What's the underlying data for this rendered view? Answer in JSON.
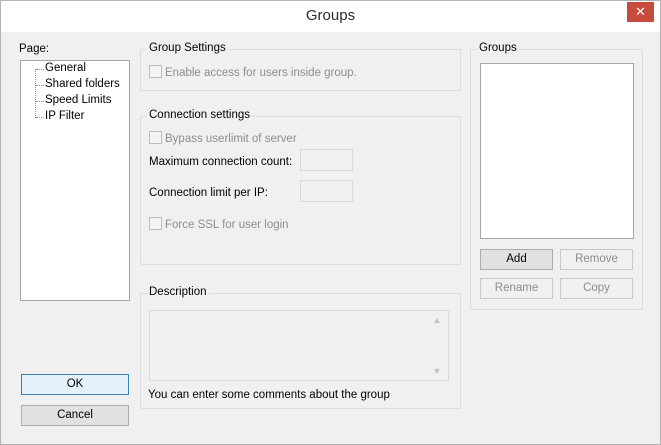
{
  "window": {
    "title": "Groups",
    "close_glyph": "✕"
  },
  "page_panel": {
    "label": "Page:",
    "items": [
      {
        "label": "General"
      },
      {
        "label": "Shared folders"
      },
      {
        "label": "Speed Limits"
      },
      {
        "label": "IP Filter"
      }
    ]
  },
  "group_settings": {
    "legend": "Group Settings",
    "enable_access_label": "Enable access for users inside group."
  },
  "connection_settings": {
    "legend": "Connection settings",
    "bypass_label": "Bypass userlimit of server",
    "max_conn_label": "Maximum connection count:",
    "max_conn_value": "",
    "conn_limit_label": "Connection limit per IP:",
    "conn_limit_value": "",
    "force_ssl_label": "Force SSL for user login"
  },
  "description": {
    "legend": "Description",
    "value": "",
    "hint": "You can enter some comments about the group"
  },
  "groups": {
    "legend": "Groups",
    "add_label": "Add",
    "remove_label": "Remove",
    "rename_label": "Rename",
    "copy_label": "Copy"
  },
  "footer": {
    "ok_label": "OK",
    "cancel_label": "Cancel"
  },
  "colors": {
    "close_button": "#c74b3b",
    "focus_border": "#3c7fb1",
    "disabled_text": "#8d8d8d"
  }
}
